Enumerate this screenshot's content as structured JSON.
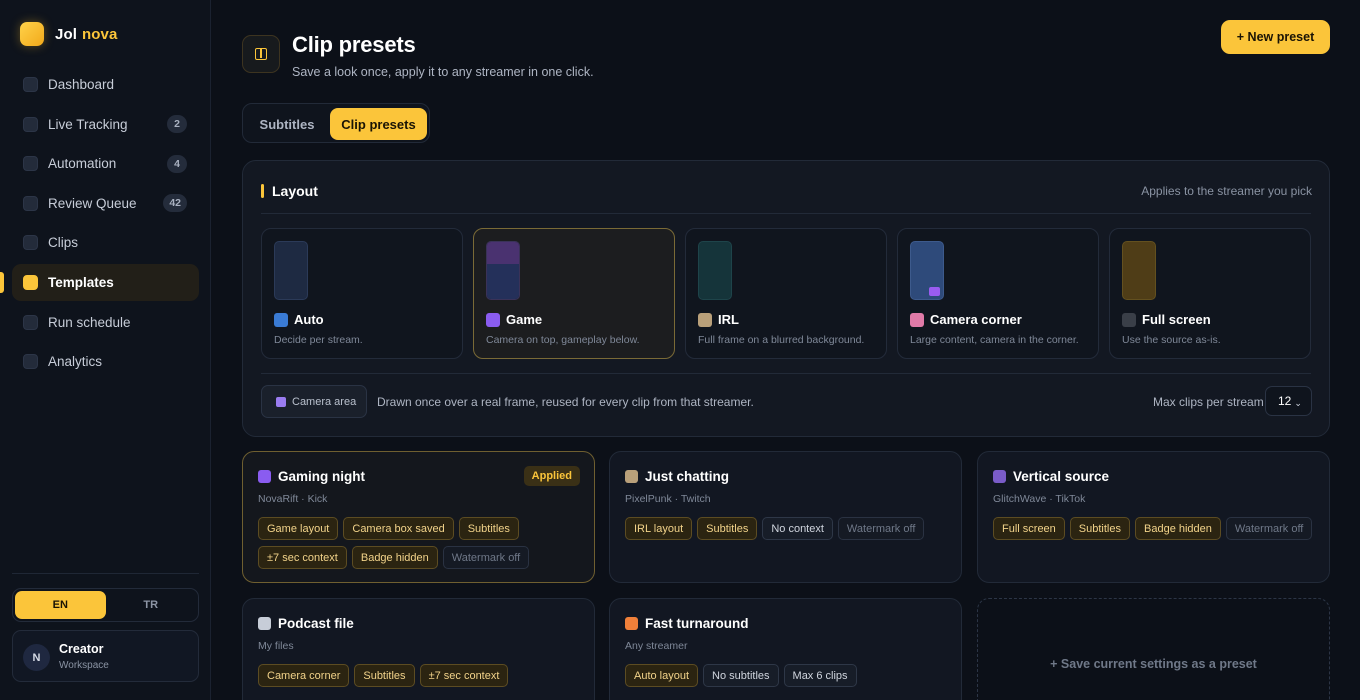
{
  "brand": {
    "name": "Jol",
    "accent": "nova"
  },
  "nav": [
    {
      "label": "Dashboard",
      "badge": ""
    },
    {
      "label": "Live Tracking",
      "badge": "2"
    },
    {
      "label": "Automation",
      "badge": "4"
    },
    {
      "label": "Review Queue",
      "badge": "42"
    },
    {
      "label": "Clips",
      "badge": ""
    },
    {
      "label": "Templates",
      "badge": "",
      "active": true
    },
    {
      "label": "Run schedule",
      "badge": ""
    },
    {
      "label": "Analytics",
      "badge": ""
    }
  ],
  "lang": {
    "en": "EN",
    "tr": "TR",
    "selected": "EN"
  },
  "user": {
    "initial": "N",
    "name": "Creator",
    "sub": "Workspace"
  },
  "header": {
    "title": "Clip presets",
    "subtitle": "Save a look once, apply it to any streamer in one click.",
    "new_button": "+ New preset"
  },
  "tabs": [
    {
      "label": "Subtitles"
    },
    {
      "label": "Clip presets",
      "active": true
    }
  ],
  "layout_panel": {
    "title": "Layout",
    "hint": "Applies to the streamer you pick",
    "options": [
      {
        "name": "Auto",
        "desc": "Decide per stream.",
        "icon": "refresh-icon",
        "color": "#3a7bd5"
      },
      {
        "name": "Game",
        "desc": "Camera on top, gameplay below.",
        "icon": "gamepad-icon",
        "color": "#8a5cf0",
        "selected": true
      },
      {
        "name": "IRL",
        "desc": "Full frame on a blurred background.",
        "icon": "pickaxe-icon",
        "color": "#b9a07a"
      },
      {
        "name": "Camera corner",
        "desc": "Large content, camera in the corner.",
        "icon": "brain-icon",
        "color": "#e07aa8"
      },
      {
        "name": "Full screen",
        "desc": "Use the source as-is.",
        "icon": "square-icon",
        "color": "#3a3f48"
      }
    ],
    "camera_area_label": "Camera area",
    "camera_area_desc": "Drawn once over a real frame, reused for every clip from that streamer.",
    "max_clips_label": "Max clips per stream",
    "max_clips_value": "12"
  },
  "presets": [
    {
      "title": "Gaming night",
      "source": "NovaRift · Kick",
      "icon": "gamepad-icon",
      "applied": true,
      "applied_label": "Applied",
      "chips": [
        {
          "t": "Game layout",
          "k": "y"
        },
        {
          "t": "Camera box saved",
          "k": "y"
        },
        {
          "t": "Subtitles",
          "k": "y"
        },
        {
          "t": "±7 sec context",
          "k": "y"
        },
        {
          "t": "Badge hidden",
          "k": "y"
        },
        {
          "t": "Watermark off",
          "k": "m"
        }
      ]
    },
    {
      "title": "Just chatting",
      "source": "PixelPunk · Twitch",
      "icon": "pickaxe-icon",
      "chips": [
        {
          "t": "IRL layout",
          "k": "y"
        },
        {
          "t": "Subtitles",
          "k": "y"
        },
        {
          "t": "No context",
          "k": "n"
        },
        {
          "t": "Watermark off",
          "k": "m"
        }
      ]
    },
    {
      "title": "Vertical source",
      "source": "GlitchWave · TikTok",
      "icon": "phone-icon",
      "chips": [
        {
          "t": "Full screen",
          "k": "y"
        },
        {
          "t": "Subtitles",
          "k": "y"
        },
        {
          "t": "Badge hidden",
          "k": "y"
        },
        {
          "t": "Watermark off",
          "k": "m"
        }
      ]
    },
    {
      "title": "Podcast file",
      "source": "My files",
      "icon": "headphones-icon",
      "chips": [
        {
          "t": "Camera corner",
          "k": "y"
        },
        {
          "t": "Subtitles",
          "k": "y"
        },
        {
          "t": "±7 sec context",
          "k": "y"
        }
      ]
    },
    {
      "title": "Fast turnaround",
      "source": "Any streamer",
      "icon": "lightning-icon",
      "chips": [
        {
          "t": "Auto layout",
          "k": "y"
        },
        {
          "t": "No subtitles",
          "k": "n"
        },
        {
          "t": "Max 6 clips",
          "k": "n"
        }
      ]
    }
  ],
  "save_preset_label": "+ Save current settings as a preset",
  "colors": {
    "accent": "#fbc53a",
    "background": "#0c1018",
    "panel": "#131822"
  }
}
